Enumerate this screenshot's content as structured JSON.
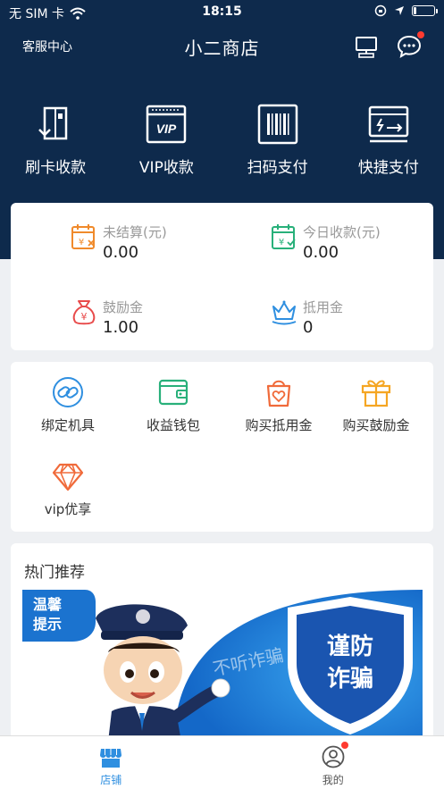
{
  "status_bar": {
    "carrier": "无 SIM 卡",
    "time": "18:15",
    "battery_level": 0.15
  },
  "navbar": {
    "left_label": "客服中心",
    "title": "小二商店"
  },
  "quick_actions": [
    {
      "label": "刷卡收款",
      "icon": "card-swipe-icon"
    },
    {
      "label": "VIP收款",
      "icon": "vip-card-icon",
      "badge_text": "VIP"
    },
    {
      "label": "扫码支付",
      "icon": "barcode-scan-icon"
    },
    {
      "label": "快捷支付",
      "icon": "quick-pay-icon"
    }
  ],
  "stats": [
    {
      "label": "未结算(元)",
      "value": "0.00",
      "icon": "unsettled-calendar-icon"
    },
    {
      "label": "今日收款(元)",
      "value": "0.00",
      "icon": "today-receipt-calendar-icon"
    },
    {
      "label": "鼓励金",
      "value": "1.00",
      "icon": "money-bag-icon"
    },
    {
      "label": "抵用金",
      "value": "0",
      "icon": "crown-icon"
    }
  ],
  "functions": [
    {
      "label": "绑定机具",
      "icon": "link-icon"
    },
    {
      "label": "收益钱包",
      "icon": "wallet-icon"
    },
    {
      "label": "购买抵用金",
      "icon": "shopping-bag-icon"
    },
    {
      "label": "购买鼓励金",
      "icon": "gift-icon"
    },
    {
      "label": "vip优享",
      "icon": "diamond-icon"
    }
  ],
  "hot": {
    "title": "热门推荐",
    "banner": {
      "tag_line1": "温馨",
      "tag_line2": "提示",
      "shield_line1": "谨防",
      "shield_line2": "诈骗",
      "bg_text": "不听诈骗"
    }
  },
  "tabbar": [
    {
      "label": "店铺",
      "active": true,
      "icon": "store-icon"
    },
    {
      "label": "我的",
      "active": false,
      "icon": "profile-icon"
    }
  ],
  "colors": {
    "header_bg": "#0e2a4c",
    "tab_active": "#2f8fe0",
    "tab_inactive": "#555555",
    "orange": "#f08a2b",
    "green": "#28b07a",
    "red": "#e84b4b",
    "blue": "#2f8fe0",
    "amber": "#f5a623"
  }
}
